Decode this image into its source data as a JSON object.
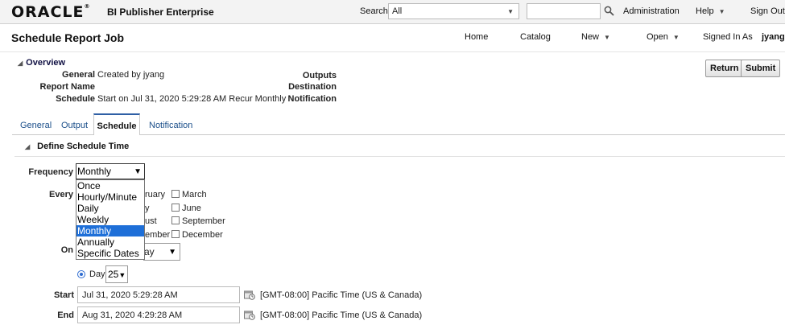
{
  "header": {
    "logo_text": "ORACLE",
    "product": "BI Publisher Enterprise",
    "search_label": "Search",
    "search_scope": "All",
    "search_value": "",
    "links": [
      "Administration",
      "Help",
      "Sign Out"
    ]
  },
  "subheader": {
    "title": "Schedule Report Job",
    "nav": [
      "Home",
      "Catalog",
      "New",
      "Open"
    ],
    "signed_in_label": "Signed In As",
    "user": "jyang"
  },
  "overview": {
    "heading": "Overview",
    "general_label": "General",
    "general_value": "Created by jyang",
    "report_name_label": "Report Name",
    "report_name_value": "",
    "schedule_label": "Schedule",
    "schedule_value": "Start on Jul 31, 2020 5:29:28 AM Recur Monthly",
    "outputs_label": "Outputs",
    "destination_label": "Destination",
    "notification_label": "Notification"
  },
  "buttons": {
    "return": "Return",
    "submit": "Submit"
  },
  "tabs": [
    "General",
    "Output",
    "Schedule",
    "Notification"
  ],
  "active_tab": "Schedule",
  "schedule": {
    "section_title": "Define Schedule Time",
    "frequency_label": "Frequency",
    "frequency_value": "Monthly",
    "frequency_options": [
      "Once",
      "Hourly/Minute",
      "Daily",
      "Weekly",
      "Monthly",
      "Annually",
      "Specific Dates"
    ],
    "every_label": "Every",
    "months_visible": [
      {
        "text": "ruary",
        "col": 1,
        "row": 0
      },
      {
        "text": "March",
        "col": 2,
        "row": 0
      },
      {
        "text": "y",
        "col": 1,
        "row": 1
      },
      {
        "text": "June",
        "col": 2,
        "row": 1
      },
      {
        "text": "ust",
        "col": 1,
        "row": 2
      },
      {
        "text": "September",
        "col": 2,
        "row": 2
      },
      {
        "text": "ember",
        "col": 1,
        "row": 3
      },
      {
        "text": "December",
        "col": 2,
        "row": 3
      }
    ],
    "on_label": "On",
    "on_day_value": "ay",
    "day_label": "Day",
    "day_value": "25",
    "start_label": "Start",
    "start_value": "Jul 31, 2020 5:29:28 AM",
    "start_tz": "[GMT-08:00] Pacific Time (US & Canada)",
    "end_label": "End",
    "end_value": "Aug 31, 2020 4:29:28 AM",
    "end_tz": "[GMT-08:00] Pacific Time (US & Canada)"
  }
}
